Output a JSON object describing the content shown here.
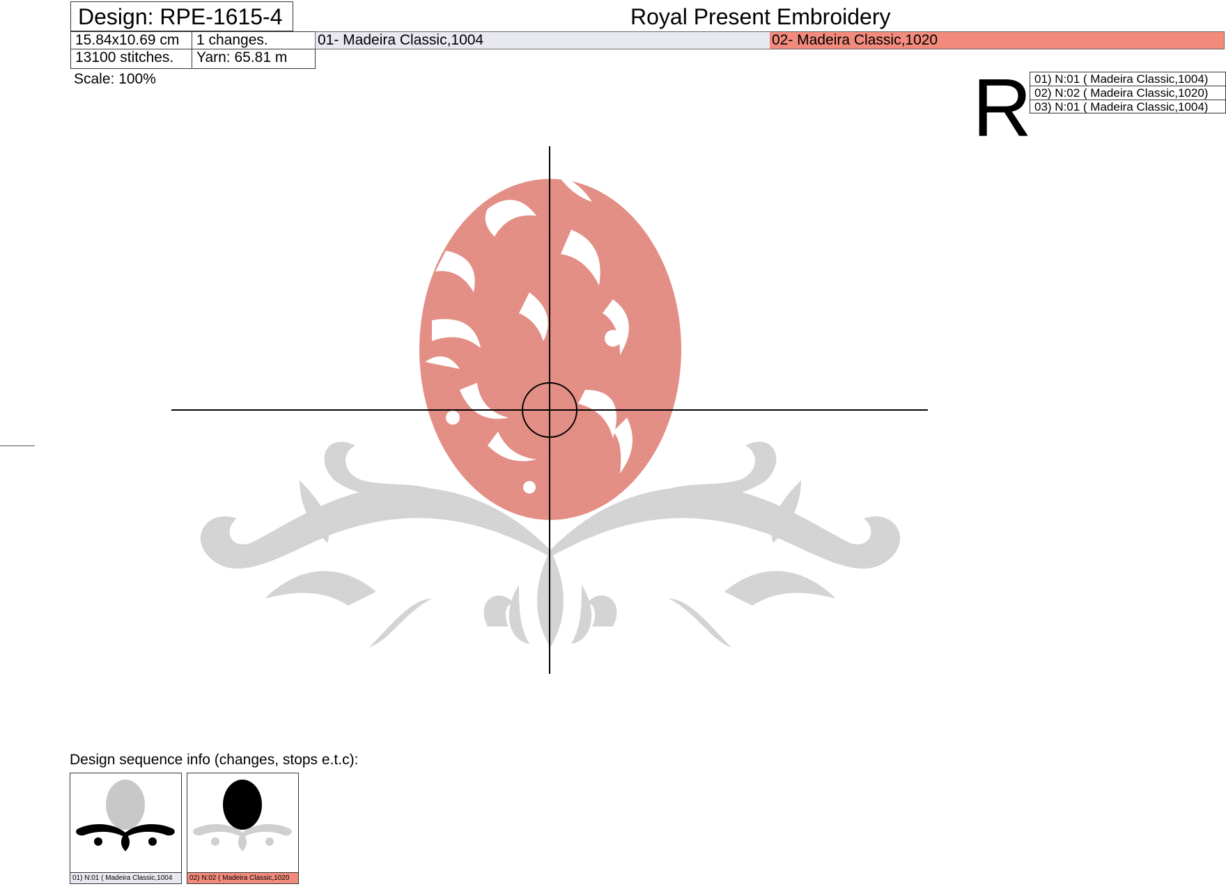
{
  "header": {
    "design": "Design: RPE-1615-4",
    "brand": "Royal Present Embroidery"
  },
  "info": {
    "size": "15.84x10.69 cm",
    "changes": "1 changes.",
    "stitches": "13100 stitches.",
    "yarn": "Yarn: 65.81 m",
    "scale": "Scale: 100%"
  },
  "colors": [
    {
      "label": "01- Madeira Classic,1004",
      "color": "#e8e8f0"
    },
    {
      "label": "02- Madeira Classic,1020",
      "color": "#f28b7c"
    }
  ],
  "hoop_letter": "R",
  "legend": [
    "01) N:01 ( Madeira Classic,1004)",
    "02) N:02 ( Madeira Classic,1020)",
    "03) N:01 ( Madeira Classic,1004)"
  ],
  "sequence": {
    "title": "Design sequence info (changes, stops e.t.c):",
    "thumbs": [
      {
        "caption": "01) N:01 ( Madeira Classic,1004",
        "caption_color": "#e8e8f0"
      },
      {
        "caption": "02) N:02 ( Madeira Classic,1020",
        "caption_color": "#f28b7c"
      }
    ]
  },
  "thread_colors": {
    "egg": "#e58f86",
    "scroll": "#d4d4d4"
  }
}
